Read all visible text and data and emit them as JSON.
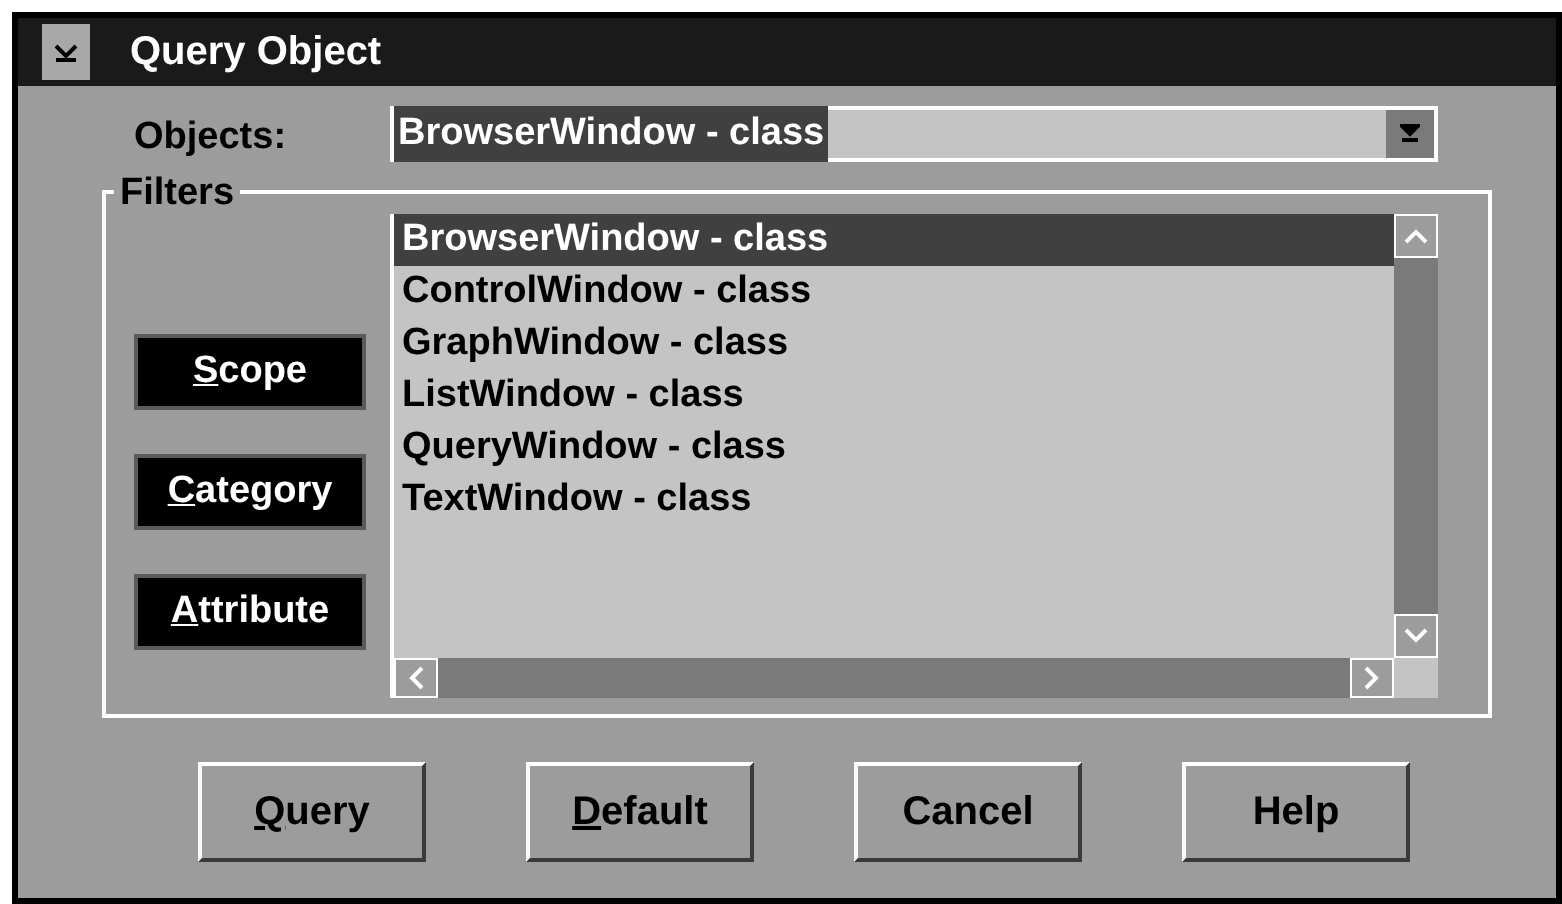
{
  "window": {
    "title": "Query Object"
  },
  "objects": {
    "label": "Objects:",
    "value": "BrowserWindow - class"
  },
  "filters": {
    "label": "Filters",
    "buttons": [
      {
        "label": "Scope",
        "mnemonic": true
      },
      {
        "label": "Category",
        "mnemonic": true
      },
      {
        "label": "Attribute",
        "mnemonic": true
      }
    ]
  },
  "list": {
    "items": [
      {
        "label": "BrowserWindow - class",
        "selected": true
      },
      {
        "label": "ControlWindow - class",
        "selected": false
      },
      {
        "label": "GraphWindow - class",
        "selected": false
      },
      {
        "label": "ListWindow - class",
        "selected": false
      },
      {
        "label": "QueryWindow - class",
        "selected": false
      },
      {
        "label": "TextWindow - class",
        "selected": false
      }
    ]
  },
  "buttons": [
    {
      "label": "Query",
      "mnemonic": true
    },
    {
      "label": "Default",
      "mnemonic": true
    },
    {
      "label": "Cancel",
      "mnemonic": false
    },
    {
      "label": "Help",
      "mnemonic": false
    }
  ]
}
